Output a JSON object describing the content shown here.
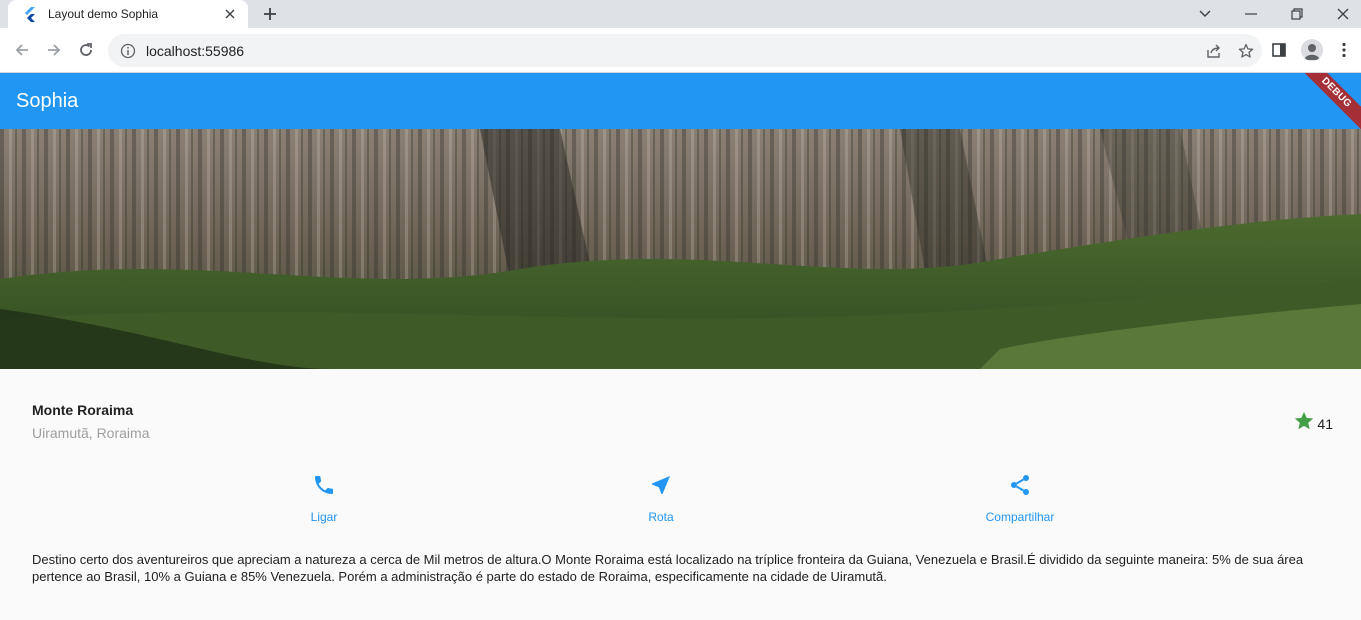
{
  "browser": {
    "tab_title": "Layout demo Sophia",
    "url": "localhost:55986"
  },
  "app": {
    "title": "Sophia",
    "debug_label": "DEBUG",
    "accent_color": "#2196f3"
  },
  "place": {
    "name": "Monte Roraima",
    "location": "Uiramutã, Roraima",
    "rating_count": "41",
    "star_color": "#43a047"
  },
  "actions": [
    {
      "label": "Ligar",
      "icon": "phone-icon"
    },
    {
      "label": "Rota",
      "icon": "navigation-icon"
    },
    {
      "label": "Compartilhar",
      "icon": "share-icon"
    }
  ],
  "description": "Destino certo dos aventureiros que apreciam a natureza a cerca de Mil metros de altura.O Monte Roraima está localizado na tríplice fronteira da Guiana, Venezuela e Brasil.É dividido da seguinte maneira: 5% de sua área pertence ao Brasil, 10% a Guiana e 85% Venezuela. Porém a administração é parte do estado de Roraima, especificamente na cidade de Uiramutã."
}
